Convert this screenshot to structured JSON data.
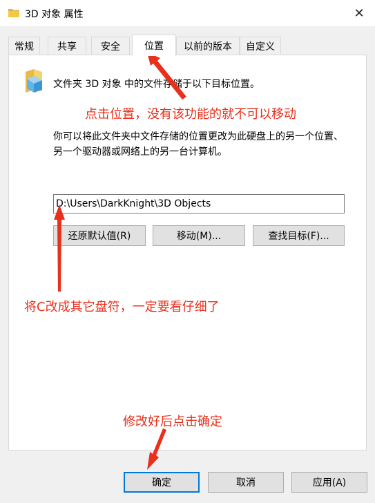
{
  "window": {
    "title": "3D 对象 属性",
    "close_glyph": "✕"
  },
  "tabs": [
    {
      "label": "常规"
    },
    {
      "label": "共享"
    },
    {
      "label": "安全"
    },
    {
      "label": "位置",
      "active": true
    },
    {
      "label": "以前的版本"
    },
    {
      "label": "自定义"
    }
  ],
  "location": {
    "description1": "文件夹 3D 对象 中的文件存储于以下目标位置。",
    "description2": "你可以将此文件夹中文件存储的位置更改为此硬盘上的另一个位置、另一个驱动器或网络上的另一台计算机。",
    "path_value": "D:\\Users\\DarkKnight\\3D Objects",
    "restore_label": "还原默认值(R)",
    "move_label": "移动(M)...",
    "find_label": "查找目标(F)..."
  },
  "annotations": {
    "click_location": "点击位置，没有该功能的就不可以移动",
    "change_drive": "将C改成其它盘符，一定要看仔细了",
    "confirm_hint": "修改好后点击确定"
  },
  "footer": {
    "ok_label": "确定",
    "cancel_label": "取消",
    "apply_label": "应用(A)"
  },
  "colors": {
    "annotation": "#e8301c",
    "accent": "#0078d7",
    "folder": "#f5c842"
  }
}
